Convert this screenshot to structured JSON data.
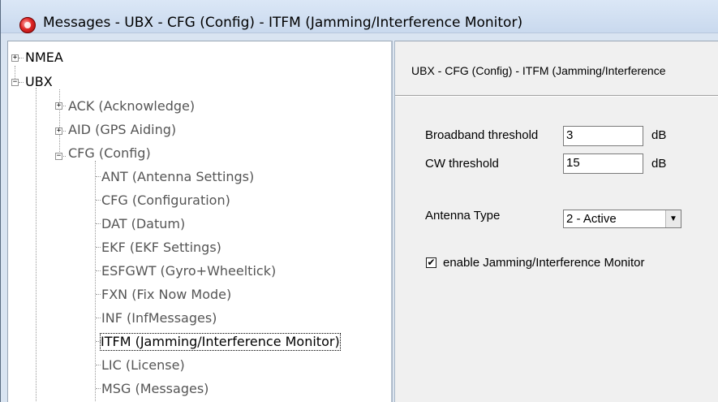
{
  "window": {
    "title": "Messages - UBX - CFG (Config) - ITFM (Jamming/Interference Monitor)",
    "icon": "app-icon"
  },
  "tree": {
    "items": [
      {
        "label": "NMEA",
        "expander": "+"
      },
      {
        "label": "UBX",
        "expander": "−"
      },
      {
        "label": "ACK (Acknowledge)",
        "expander": "+"
      },
      {
        "label": "AID (GPS Aiding)",
        "expander": "+"
      },
      {
        "label": "CFG (Config)",
        "expander": "−"
      },
      {
        "label": "ANT (Antenna Settings)"
      },
      {
        "label": "CFG (Configuration)"
      },
      {
        "label": "DAT (Datum)"
      },
      {
        "label": "EKF (EKF Settings)"
      },
      {
        "label": "ESFGWT (Gyro+Wheeltick)"
      },
      {
        "label": "FXN (Fix Now Mode)"
      },
      {
        "label": "INF (InfMessages)"
      },
      {
        "label": "ITFM (Jamming/Interference Monitor)",
        "selected": true
      },
      {
        "label": "LIC (License)"
      },
      {
        "label": "MSG (Messages)"
      }
    ]
  },
  "panel": {
    "header": "UBX - CFG (Config) - ITFM (Jamming/Interference",
    "broadband": {
      "label": "Broadband threshold",
      "value": "3",
      "unit": "dB"
    },
    "cw": {
      "label": "CW threshold",
      "value": "15",
      "unit": "dB"
    },
    "antenna": {
      "label": "Antenna Type",
      "selected": "2 - Active"
    },
    "enable": {
      "label": "enable Jamming/Interference Monitor",
      "checked": true,
      "check_mark": "✔"
    }
  }
}
